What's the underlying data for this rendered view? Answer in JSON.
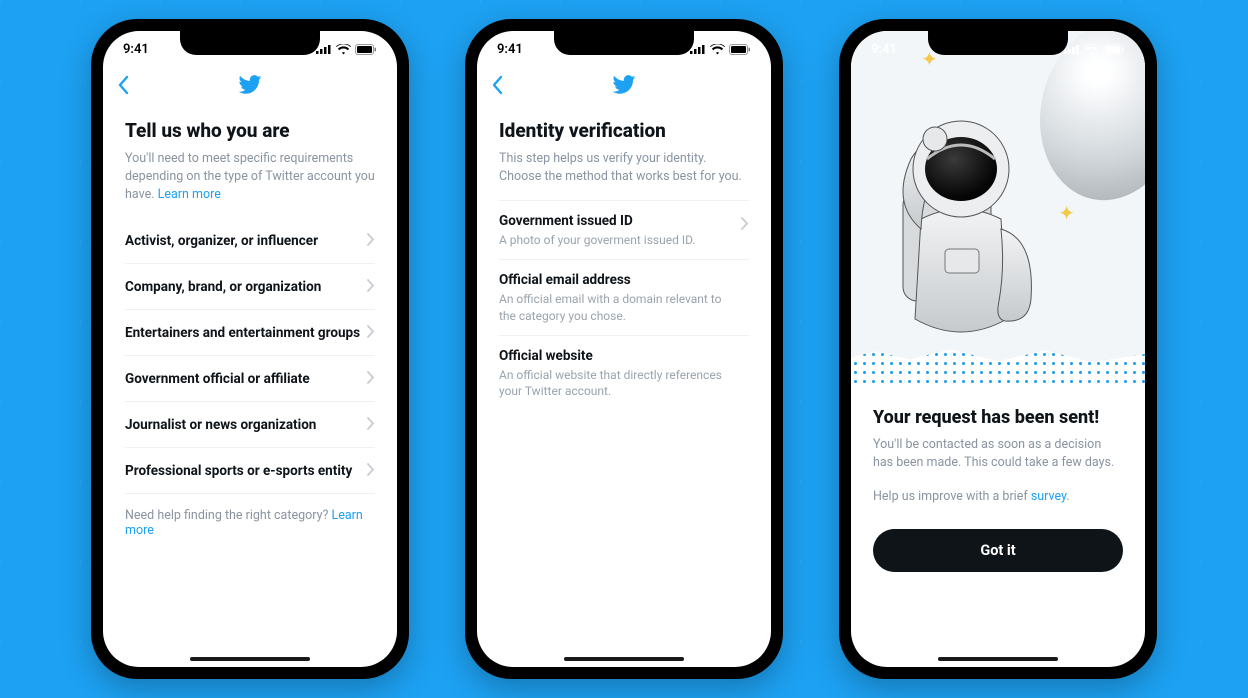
{
  "status": {
    "time": "9:41"
  },
  "colors": {
    "accent": "#1da1f2",
    "text": "#0f1419",
    "muted": "#8a94a0"
  },
  "screen1": {
    "title": "Tell us who you are",
    "subtitle_pre": "You'll need to meet specific requirements depending on the type of Twitter account you have. ",
    "subtitle_link": "Learn more",
    "categories": [
      "Activist, organizer, or influencer",
      "Company, brand, or organization",
      "Entertainers and entertainment groups",
      "Government official or affiliate",
      "Journalist or news organization",
      "Professional sports or e-sports entity"
    ],
    "help_text": "Need help finding the right category? ",
    "help_link": "Learn more"
  },
  "screen2": {
    "title": "Identity verification",
    "subtitle": "This step helps us verify your identity. Choose the method that works best for you.",
    "methods": [
      {
        "label": "Government issued ID",
        "desc": "A photo of your goverment issued ID."
      },
      {
        "label": "Official email address",
        "desc": "An official email with a domain relevant to the category you chose."
      },
      {
        "label": "Official website",
        "desc": "An official website that directly references your Twitter account."
      }
    ]
  },
  "screen3": {
    "title": "Your request has been sent!",
    "body": "You'll be contacted as soon as a decision has been made. This could take a few days.",
    "survey_pre": "Help us improve with a brief ",
    "survey_link": "survey",
    "survey_post": ".",
    "button": "Got it"
  }
}
